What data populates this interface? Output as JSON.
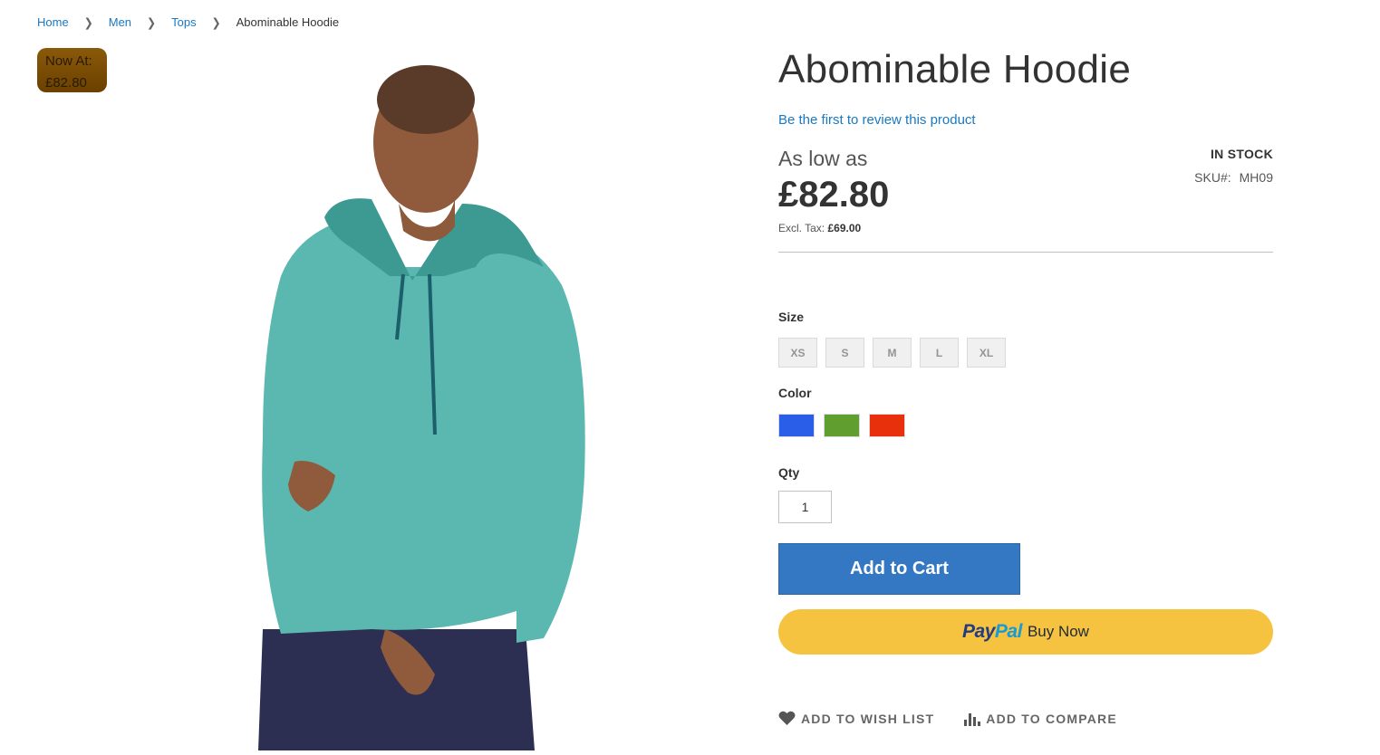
{
  "breadcrumbs": {
    "items": [
      {
        "label": "Home"
      },
      {
        "label": "Men"
      },
      {
        "label": "Tops"
      }
    ],
    "current": "Abominable Hoodie",
    "separator": "❯"
  },
  "badge": {
    "line1": "Now At:",
    "line2": "£82.80"
  },
  "product": {
    "title": "Abominable Hoodie",
    "review_link": "Be the first to review this product",
    "price_label": "As low as",
    "price": "£82.80",
    "excl_label": "Excl. Tax:",
    "excl_value": "£69.00",
    "stock": "IN STOCK",
    "sku_label": "SKU#:",
    "sku_value": "MH09"
  },
  "options": {
    "size_label": "Size",
    "sizes": [
      "XS",
      "S",
      "M",
      "L",
      "XL"
    ],
    "color_label": "Color",
    "colors": [
      "#2a5de8",
      "#5f9e2f",
      "#e8300c"
    ],
    "qty_label": "Qty",
    "qty_value": "1"
  },
  "buttons": {
    "add_to_cart": "Add to Cart",
    "paypal_pay": "Pay",
    "paypal_pal": "Pal",
    "paypal_buy_now": "Buy Now",
    "wishlist": "ADD TO WISH LIST",
    "compare": "ADD TO COMPARE"
  },
  "icons": {
    "wishlist": "heart-icon",
    "compare": "bar-chart-icon"
  },
  "colors": {
    "link": "#1979c3",
    "primary": "#3477c3",
    "paypal": "#f5c33f"
  }
}
